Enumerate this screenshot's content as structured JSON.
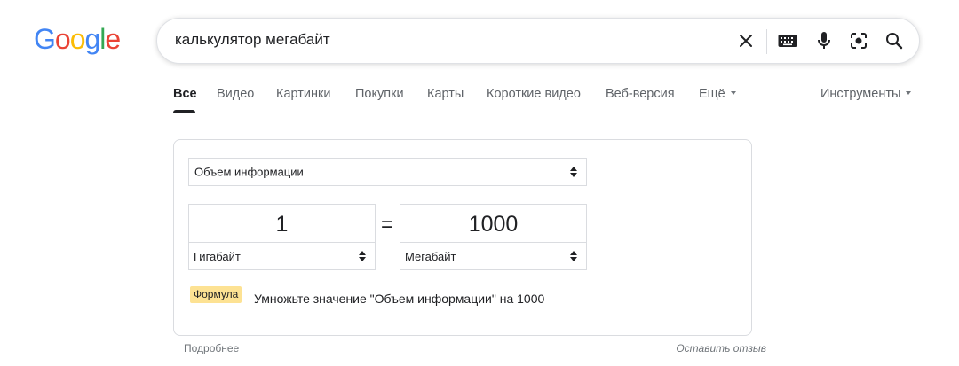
{
  "logo": {
    "letters": [
      "G",
      "o",
      "o",
      "g",
      "l",
      "e"
    ],
    "colors": [
      "#4285f4",
      "#ea4335",
      "#fbbc05",
      "#4285f4",
      "#34a853",
      "#ea4335"
    ]
  },
  "search": {
    "query": "калькулятор мегабайт",
    "icons": [
      "close-icon",
      "keyboard-icon",
      "microphone-icon",
      "lens-icon",
      "search-icon"
    ]
  },
  "tabs": [
    {
      "label": "Все",
      "active": true
    },
    {
      "label": "Видео"
    },
    {
      "label": "Картинки"
    },
    {
      "label": "Покупки"
    },
    {
      "label": "Карты"
    },
    {
      "label": "Короткие видео"
    },
    {
      "label": "Веб-версия"
    },
    {
      "label": "Ещё",
      "dropdown": true
    }
  ],
  "tools_label": "Инструменты",
  "converter": {
    "category": "Объем информации",
    "from": {
      "value": "1",
      "unit": "Гигабайт"
    },
    "equals": "=",
    "to": {
      "value": "1000",
      "unit": "Мегабайт"
    },
    "formula_badge": "Формула",
    "formula_text": "Умножьте значение \"Объем информации\" на 1000"
  },
  "footer": {
    "more": "Подробнее",
    "feedback": "Оставить отзыв"
  },
  "colors": {
    "accent_text": "#202124",
    "muted_text": "#5f6368",
    "badge_bg": "#fde293",
    "border": "#dadce0"
  }
}
